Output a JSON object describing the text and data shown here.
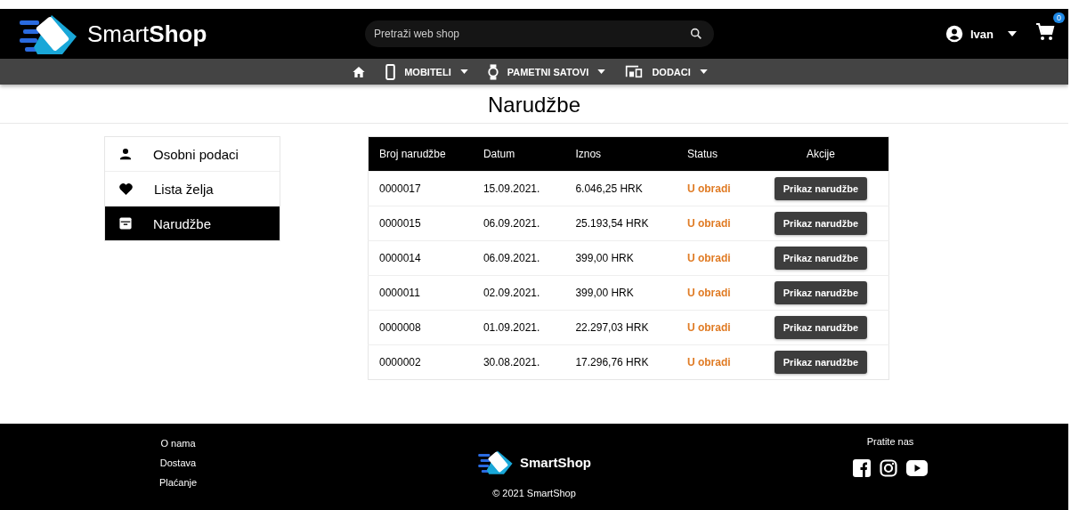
{
  "header": {
    "logo": "Smart**Shop**",
    "search": {
      "placeholder": "Pretraži web shop"
    },
    "user": "Ivan",
    "cart_count": "0"
  },
  "nav": [
    {
      "kind": "home"
    },
    {
      "kind": "phone",
      "label": "MOBITELI"
    },
    {
      "kind": "watch",
      "label": "PAMETNI SATOVI"
    },
    {
      "kind": "devices",
      "label": "DODACI"
    }
  ],
  "page_title": "Narudžbe",
  "sidebar": {
    "items": [
      {
        "kind": "person",
        "label": "Osobni podaci",
        "selected": false
      },
      {
        "kind": "heart",
        "label": "Lista želja",
        "selected": false
      },
      {
        "kind": "archive",
        "label": "Narudžbe",
        "selected": true
      }
    ]
  },
  "table": {
    "columns": [
      "Broj narudžbe",
      "Datum",
      "Iznos",
      "Status",
      "Akcije"
    ],
    "rows": [
      {
        "number": "0000017",
        "date": "15.09.2021.",
        "amount": "6.046,25 HRK",
        "status": "U obradi",
        "action": "Prikaz narudžbe"
      },
      {
        "number": "0000015",
        "date": "06.09.2021.",
        "amount": "25.193,54 HRK",
        "status": "U obradi",
        "action": "Prikaz narudžbe"
      },
      {
        "number": "0000014",
        "date": "06.09.2021.",
        "amount": "399,00 HRK",
        "status": "U obradi",
        "action": "Prikaz narudžbe"
      },
      {
        "number": "0000011",
        "date": "02.09.2021.",
        "amount": "399,00 HRK",
        "status": "U obradi",
        "action": "Prikaz narudžbe"
      },
      {
        "number": "0000008",
        "date": "01.09.2021.",
        "amount": "22.297,03 HRK",
        "status": "U obradi",
        "action": "Prikaz narudžbe"
      },
      {
        "number": "0000002",
        "date": "30.08.2021.",
        "amount": "17.296,76 HRK",
        "status": "U obradi",
        "action": "Prikaz narudžbe"
      }
    ]
  },
  "footer": {
    "links": [
      "O nama",
      "Dostava",
      "Plaćanje"
    ],
    "logo": "SmartShop",
    "copyright": "© 2021 SmartShop",
    "follow": "Pratite nas"
  }
}
